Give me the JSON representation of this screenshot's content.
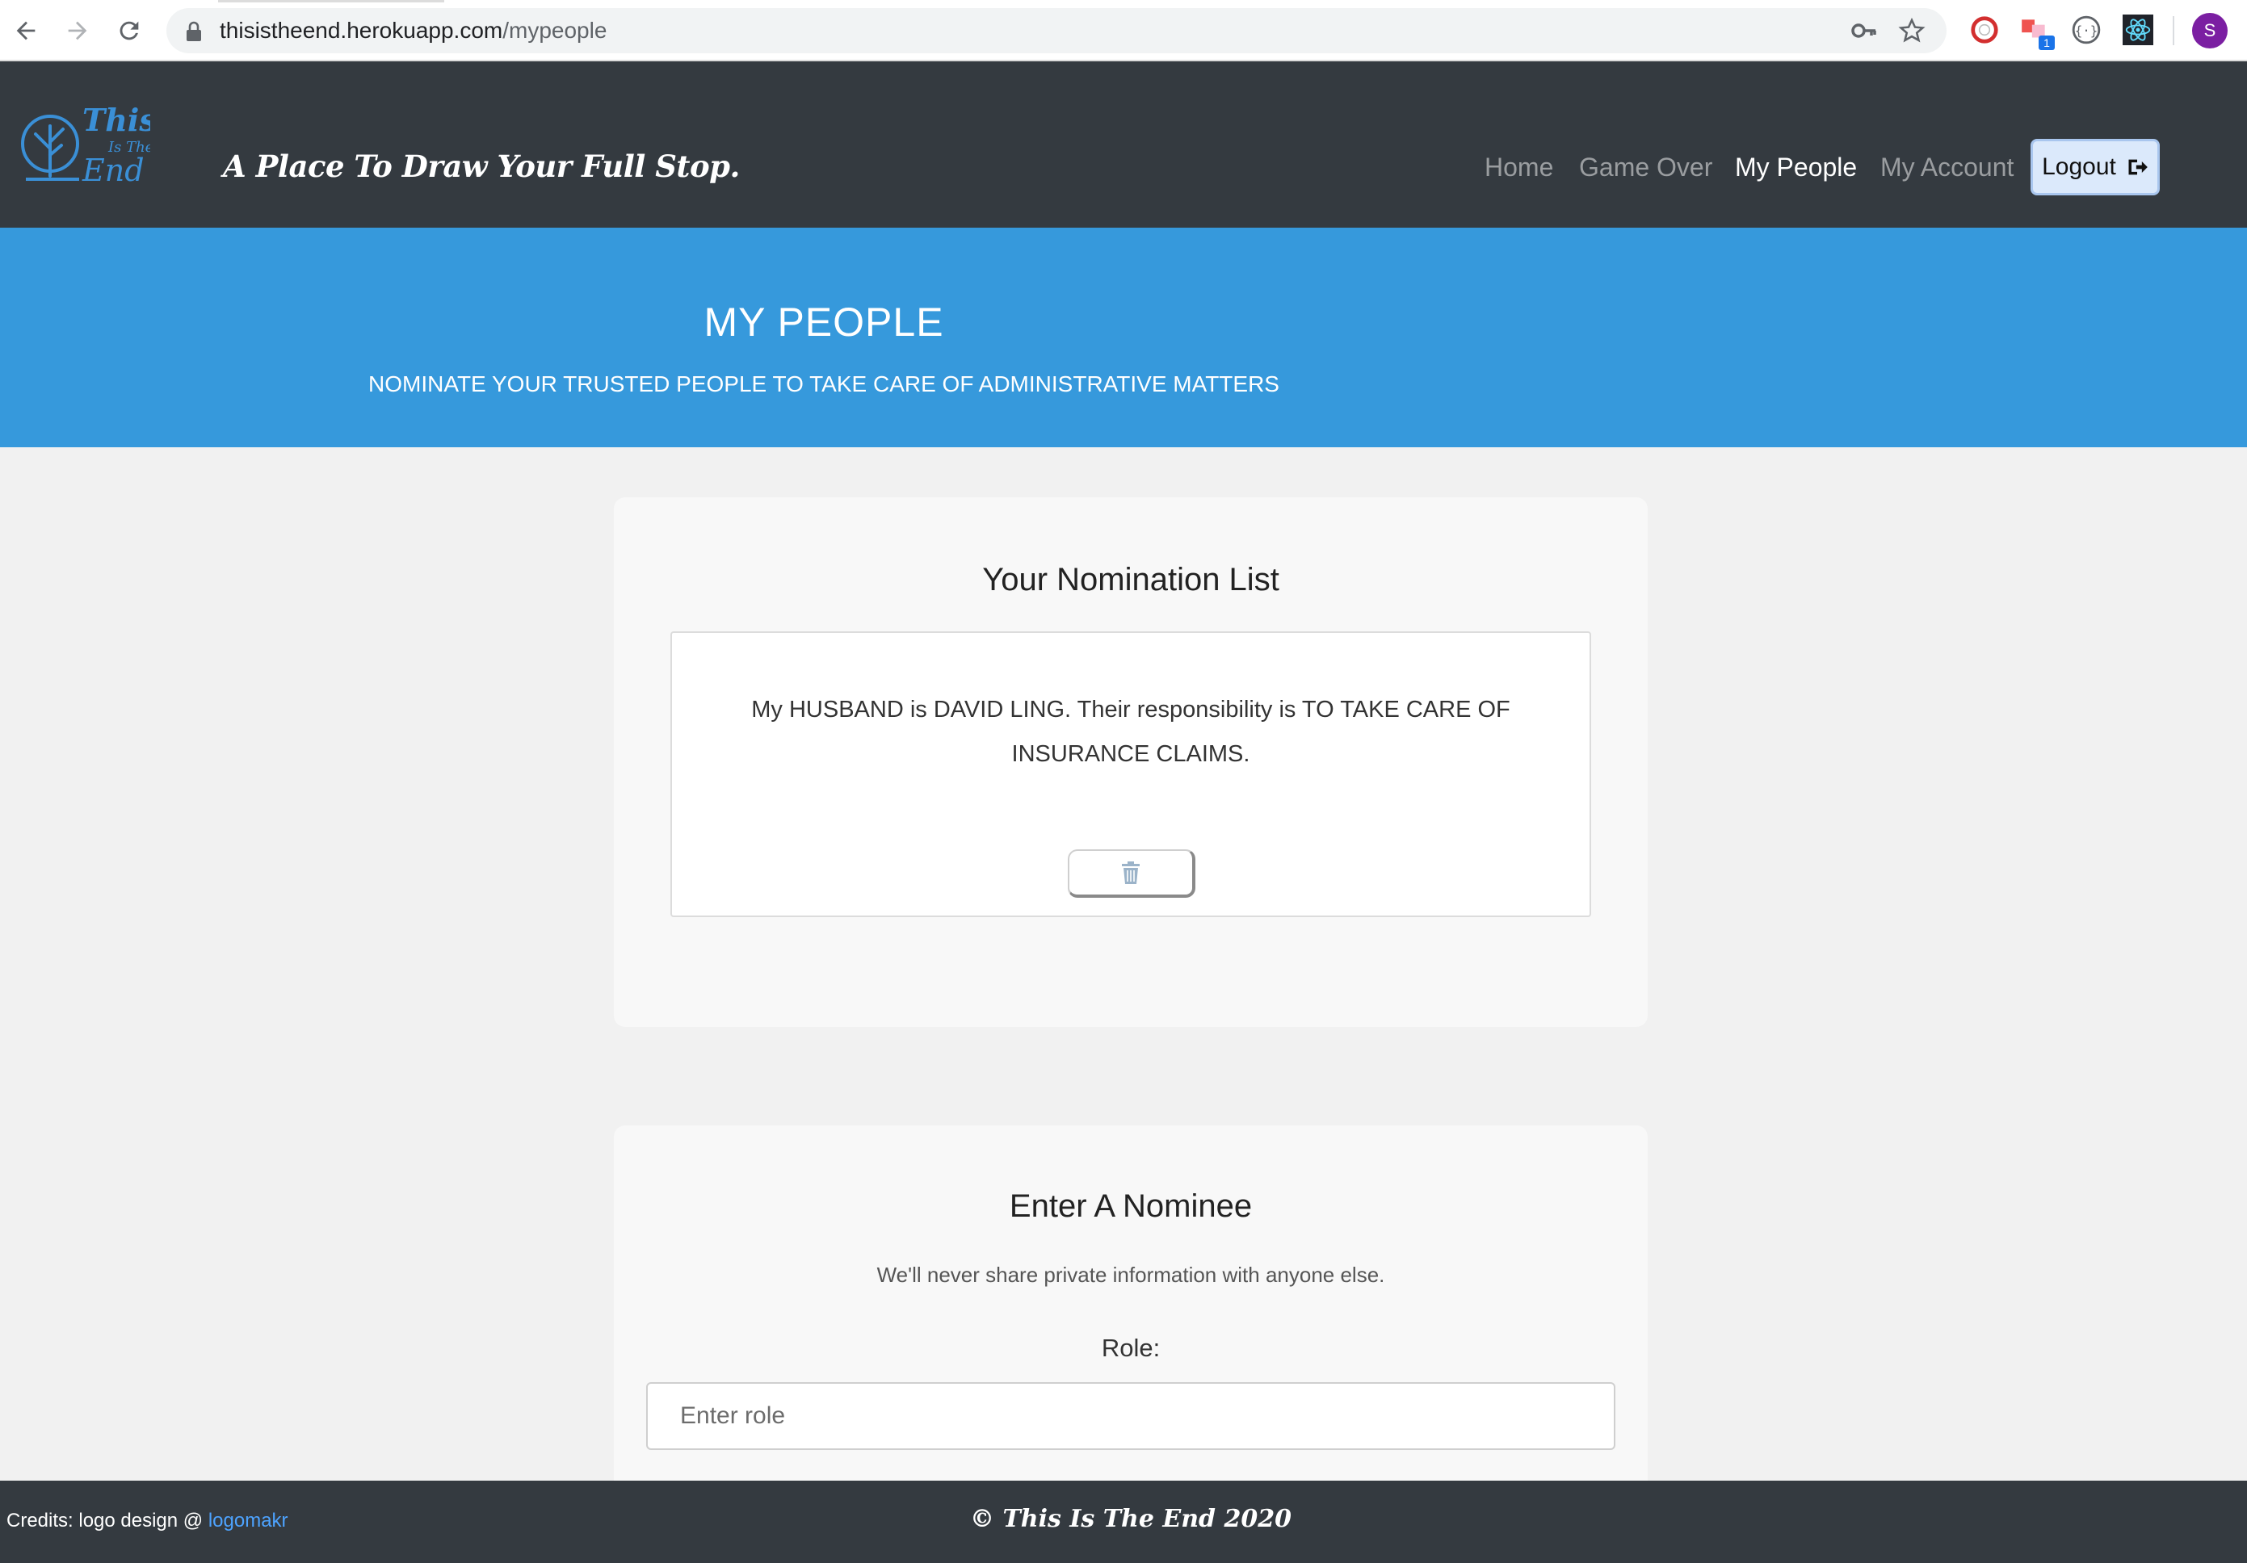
{
  "browser": {
    "url_host": "thisistheend.herokuapp.com",
    "url_path": "/mypeople",
    "profile_initial": "S",
    "extension_badge": "1"
  },
  "navbar": {
    "brand_logo_text": [
      "This",
      "Is The",
      "End"
    ],
    "tagline": "A Place To Draw Your Full Stop.",
    "links": [
      {
        "label": "Home",
        "active": false
      },
      {
        "label": "Game Over",
        "active": false
      },
      {
        "label": "My People",
        "active": true
      },
      {
        "label": "My Account",
        "active": false
      }
    ],
    "logout_label": "Logout"
  },
  "hero": {
    "title": "MY PEOPLE",
    "subtitle": "NOMINATE YOUR TRUSTED PEOPLE TO TAKE CARE OF ADMINISTRATIVE MATTERS"
  },
  "nomination_list": {
    "title": "Your Nomination List",
    "items": [
      {
        "text": "My HUSBAND is DAVID LING. Their responsibility is TO TAKE CARE OF INSURANCE CLAIMS."
      }
    ]
  },
  "nominee_form": {
    "title": "Enter A Nominee",
    "hint": "We'll never share private information with anyone else.",
    "role_label": "Role:",
    "role_placeholder": "Enter role",
    "role_value": ""
  },
  "footer": {
    "credits_prefix": "Credits: logo design @ ",
    "credits_link": "logomakr",
    "copyright": "© This Is The End 2020"
  },
  "colors": {
    "navbar_bg": "#343a40",
    "hero_bg": "#3699dc",
    "page_bg": "#f1f1f1",
    "card_bg": "#f8f8f8",
    "logo_blue": "#3a8fd6"
  }
}
